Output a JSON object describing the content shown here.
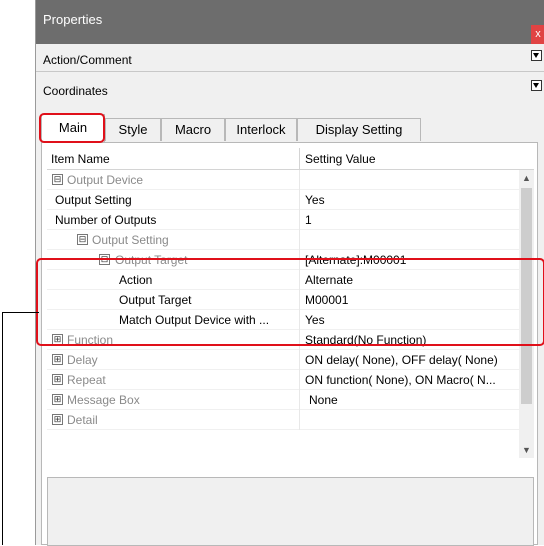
{
  "window": {
    "title": "Properties",
    "close_label": "x"
  },
  "sections": [
    {
      "label": "Action/Comment"
    },
    {
      "label": "Coordinates"
    }
  ],
  "tabs": [
    {
      "label": "Main",
      "active": true
    },
    {
      "label": "Style"
    },
    {
      "label": "Macro"
    },
    {
      "label": "Interlock"
    },
    {
      "label": "Display Setting"
    }
  ],
  "grid": {
    "col_item": "Item Name",
    "col_value": "Setting Value",
    "rows": [
      {
        "name": "Output Device",
        "value": "",
        "expander": "⊟"
      },
      {
        "name": "Output Setting",
        "value": "Yes"
      },
      {
        "name": "Number of Outputs",
        "value": "1"
      },
      {
        "name": "Output Setting",
        "value": "",
        "expander": "⊟"
      },
      {
        "name": "Output Target",
        "value": "[Alternate]:M00001",
        "expander": "⊟"
      },
      {
        "name": "Action",
        "value": "Alternate"
      },
      {
        "name": "Output Target",
        "value": "M00001"
      },
      {
        "name": "Match Output Device with ...",
        "value": "Yes"
      },
      {
        "name": "Function",
        "value": "Standard(No Function)",
        "expander": "⊞"
      },
      {
        "name": "Delay",
        "value": "ON delay( None), OFF delay( None)",
        "expander": "⊞"
      },
      {
        "name": "Repeat",
        "value": "ON function( None), ON Macro( N...",
        "expander": "⊞"
      },
      {
        "name": "Message Box",
        "value": "None",
        "expander": "⊞"
      },
      {
        "name": "Detail",
        "value": "",
        "expander": "⊞"
      }
    ]
  },
  "scroll": {
    "up": "▲",
    "down": "▼"
  },
  "colors": {
    "titlebar": "#6d6d6d",
    "close": "#e04343",
    "highlight": "#e0101a"
  }
}
